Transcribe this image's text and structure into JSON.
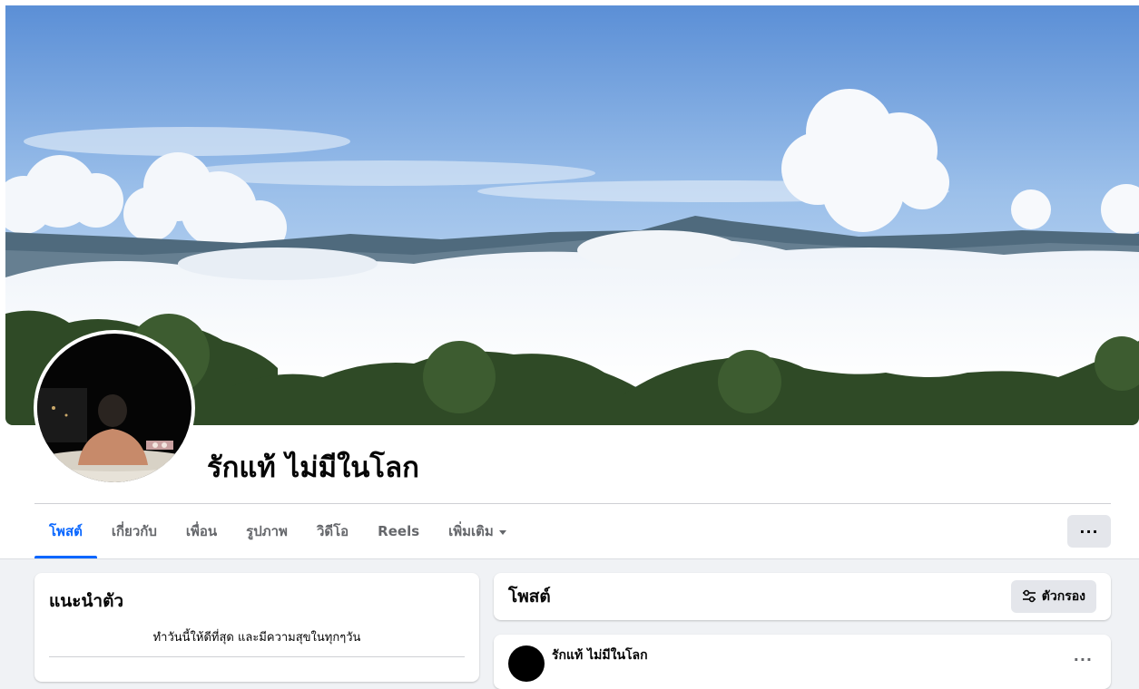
{
  "profile": {
    "name": "รักแท้ ไม่มีในโลก",
    "bio": "ทำวันนี้ให้ดีที่สุด และมีความสุขในทุกๆวัน"
  },
  "tabs": [
    {
      "label": "โพสต์",
      "active": true
    },
    {
      "label": "เกี่ยวกับ",
      "active": false
    },
    {
      "label": "เพื่อน",
      "active": false
    },
    {
      "label": "รูปภาพ",
      "active": false
    },
    {
      "label": "วิดีโอ",
      "active": false
    },
    {
      "label": "Reels",
      "active": false
    },
    {
      "label": "เพิ่มเติม",
      "active": false
    }
  ],
  "more_button": "···",
  "intro": {
    "title": "แนะนำตัว"
  },
  "posts": {
    "title": "โพสต์",
    "filter_label": "ตัวกรอง",
    "first_post_author": "รักแท้ ไม่มีในโลก",
    "post_menu": "···"
  },
  "colors": {
    "accent": "#0866ff",
    "page_bg": "#f0f2f5",
    "button_bg": "#e4e6eb",
    "muted_text": "#65676b"
  },
  "icons": {
    "cover": "cover-photo-mountains",
    "filter": "sliders-icon",
    "dropdown": "chevron-down-icon"
  }
}
